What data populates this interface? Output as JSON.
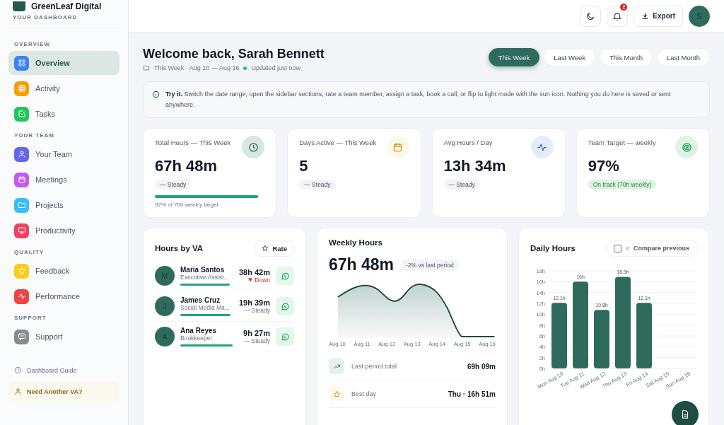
{
  "brand": {
    "name": "GreenLeaf Digital",
    "subtitle": "YOUR DASHBOARD"
  },
  "sidebar": {
    "sections": [
      {
        "title": "OVERVIEW",
        "items": [
          {
            "label": "Overview",
            "kind": "grid",
            "color": "#3b82f6",
            "selected": true
          },
          {
            "label": "Activity",
            "kind": "table",
            "color": "#f59e0b",
            "selected": false
          },
          {
            "label": "Tasks",
            "kind": "check",
            "color": "#22c55e",
            "selected": false
          }
        ]
      },
      {
        "title": "YOUR TEAM",
        "items": [
          {
            "label": "Your Team",
            "kind": "user",
            "color": "#6366f1",
            "selected": false
          },
          {
            "label": "Meetings",
            "kind": "calendar",
            "color": "#c05cf0",
            "selected": false
          },
          {
            "label": "Projects",
            "kind": "folder",
            "color": "#38bdf8",
            "selected": false
          },
          {
            "label": "Productivity",
            "kind": "monitor",
            "color": "#f43f5e",
            "selected": false
          }
        ]
      },
      {
        "title": "QUALITY",
        "items": [
          {
            "label": "Feedback",
            "kind": "star",
            "color": "#facc15",
            "selected": false
          },
          {
            "label": "Performance",
            "kind": "pulse",
            "color": "#ef4444",
            "selected": false
          }
        ]
      },
      {
        "title": "SUPPORT",
        "items": [
          {
            "label": "Support",
            "kind": "chat",
            "color": "#8b8b8b",
            "selected": false
          }
        ]
      }
    ],
    "guide": "Dashboard Guide",
    "cta": "Need Another VA?"
  },
  "header": {
    "notifications": "2",
    "export": "Export",
    "avatar": "S"
  },
  "welcome": {
    "title": "Welcome back, Sarah Bennett",
    "range": "This Week · Aug 10 — Aug 16",
    "status": "Updated just now"
  },
  "ranges": [
    {
      "label": "This Week",
      "selected": true
    },
    {
      "label": "Last Week",
      "selected": false
    },
    {
      "label": "This Month",
      "selected": false
    },
    {
      "label": "Last Month",
      "selected": false
    }
  ],
  "notice": "**Try it.** Switch the date range, open the sidebar sections, rate a team member, assign a task, book a call, or flip to light mode with the sun icon. Nothing you do here is saved or sent anywhere.",
  "stats": [
    {
      "label": "Total Hours — This Week",
      "value": "67h 48m",
      "badge": {
        "label": "— Steady",
        "color": "#f3f4f6"
      },
      "kind": "clock",
      "level": 0.97,
      "note": "97% of 70h weekly target"
    },
    {
      "label": "Days Active — This Week",
      "value": "5",
      "badge": {
        "label": "— Steady",
        "color": "#f3f4f6"
      },
      "kind": "calendar"
    },
    {
      "label": "Avg Hours / Day",
      "value": "13h 34m",
      "badge": {
        "label": "— Steady",
        "color": "#f3f4f6"
      },
      "kind": "pulse"
    },
    {
      "label": "Team Target — weekly",
      "value": "97%",
      "badge": {
        "label": "On track (70h weekly)",
        "color": "#dcf5e3"
      },
      "kind": "target"
    }
  ],
  "hours_by_va": {
    "title": "Hours by VA",
    "rate": "Rate",
    "rows": [
      {
        "initial": "M",
        "name": "Maria Santos",
        "role": "Executive Assist...",
        "level": 0.95,
        "hours": "38h 42m",
        "trend": "Down",
        "kind": "down"
      },
      {
        "initial": "J",
        "name": "James Cruz",
        "role": "Social Media Ma...",
        "level": 0.96,
        "hours": "19h 39m",
        "trend": "— Steady",
        "kind": "steady"
      },
      {
        "initial": "A",
        "name": "Ana Reyes",
        "role": "Bookkeeper",
        "level": 1.0,
        "hours": "9h 27m",
        "trend": "— Steady",
        "kind": "steady"
      }
    ]
  },
  "weekly": {
    "title": "Weekly Hours",
    "total": "67h 48m",
    "delta": "-2% vs last period",
    "x_labels": [
      "Aug 10",
      "Aug 11",
      "Aug 12",
      "Aug 13",
      "Aug 14",
      "Aug 15",
      "Aug 16"
    ],
    "rows": [
      {
        "label": "Last period total",
        "value": "69h 09m",
        "kind": "trend"
      },
      {
        "label": "Best day",
        "value": "Thu · 16h 51m",
        "kind": "star"
      }
    ]
  },
  "daily": {
    "title": "Daily Hours",
    "compare": {
      "label": "Compare previous",
      "checked": false
    },
    "chart_data": {
      "type": "bar",
      "categories": [
        "Mon Aug 10",
        "Tue Aug 11",
        "Wed Aug 12",
        "Thu Aug 13",
        "Fri Aug 14",
        "Sat Aug 15",
        "Sun Aug 16"
      ],
      "series": [
        {
          "color": "#2f6b5c",
          "values": [
            12.1,
            16,
            10.8,
            16.9,
            12.1,
            null,
            null
          ]
        }
      ],
      "ylim": [
        0,
        18
      ],
      "yticks": [
        {
          "value": 0,
          "label": "0h"
        },
        {
          "value": 2,
          "label": "2h"
        },
        {
          "value": 4,
          "label": "4h"
        },
        {
          "value": 6,
          "label": "6h"
        },
        {
          "value": 8,
          "label": "8h"
        },
        {
          "value": 10,
          "label": "10h"
        },
        {
          "value": 12,
          "label": "12h"
        },
        {
          "value": 14,
          "label": "14h"
        },
        {
          "value": 16,
          "label": "16h"
        },
        {
          "value": 18,
          "label": "18h"
        }
      ],
      "grid": true,
      "value_labels": [
        "12.1h",
        "16h",
        "10.8h",
        "16.9h",
        "12.1h",
        null,
        null
      ]
    }
  }
}
